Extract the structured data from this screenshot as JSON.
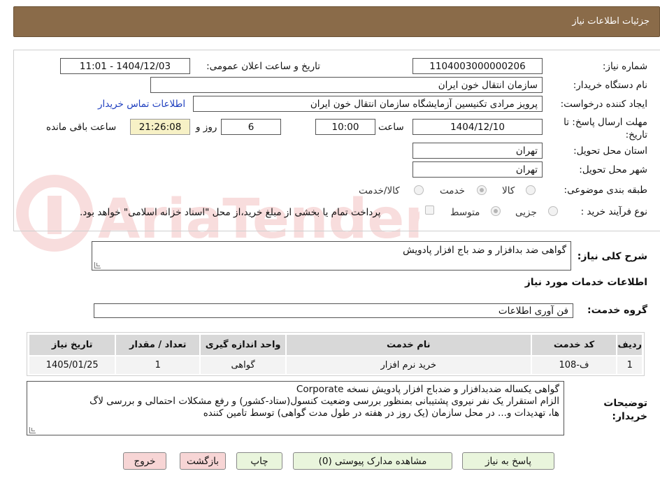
{
  "header": {
    "title": "جزئیات اطلاعات نیاز"
  },
  "form": {
    "need_number_label": "شماره نیاز:",
    "need_number": "1104003000000206",
    "announce_label": "تاریخ و ساعت اعلان عمومی:",
    "announce_value": "1404/12/03 - 11:01",
    "buyer_org_label": "نام دستگاه خریدار:",
    "buyer_org": "سازمان انتقال خون ایران",
    "requester_label": "ایجاد کننده درخواست:",
    "requester": "پرویز مرادی تکنیسین آزمایشگاه سازمان انتقال خون ایران",
    "contact_link": "اطلاعات تماس خریدار",
    "deadline_label": "مهلت ارسال پاسخ: تا تاریخ:",
    "deadline_date": "1404/12/10",
    "time_label": "ساعت",
    "deadline_time": "10:00",
    "days_value": "6",
    "days_label": "روز و",
    "remaining_time": "21:26:08",
    "remaining_label": "ساعت باقی مانده",
    "province_label": "استان محل تحویل:",
    "province": "تهران",
    "city_label": "شهر محل تحویل:",
    "city": "تهران",
    "category_label": "طبقه بندی موضوعی:",
    "category_options": [
      "کالا",
      "خدمت",
      "کالا/خدمت"
    ],
    "purchase_type_label": "نوع فرآیند خرید :",
    "purchase_options": [
      "جزیی",
      "متوسط"
    ],
    "payment_note": "پرداخت تمام یا بخشی از مبلغ خرید،از محل \"اسناد خزانه اسلامی\" خواهد بود."
  },
  "description": {
    "label": "شرح کلی نیاز:",
    "value": "گواهی ضد بدافزار و ضد باج افزار پادویش"
  },
  "services": {
    "title": "اطلاعات خدمات مورد نیاز",
    "group_label": "گروه خدمت:",
    "group_value": "فن آوری اطلاعات",
    "columns": [
      "ردیف",
      "کد خدمت",
      "نام خدمت",
      "واحد اندازه گیری",
      "تعداد / مقدار",
      "تاریخ نیاز"
    ],
    "rows": [
      [
        "1",
        "ف-108",
        "خرید نرم افزار",
        "گواهی",
        "1",
        "1405/01/25"
      ]
    ]
  },
  "buyer_notes": {
    "label": "توضیحات خریدار:",
    "lines": [
      "گواهی یکساله ضدبدافزار و ضدباج افزار پادویش نسخه Corporate",
      "الزام استقرار یک نفر نیروی پشتیبانی بمنظور بررسی وضعیت کنسول(ستاد-کشور) و رفع مشکلات احتمالی و بررسی لاگ",
      "ها، تهدیدات و... در محل سازمان  (یک روز در هفته در طول مدت گواهی) توسط تامین کننده"
    ]
  },
  "buttons": {
    "respond": "پاسخ به نیاز",
    "attachments": "مشاهده مدارک پیوستی (0)",
    "print": "چاپ",
    "back": "بازگشت",
    "exit": "خروج"
  },
  "watermark": {
    "text": "AriaTender.neT"
  },
  "colors": {
    "header_bg": "#8a6b49",
    "timer_bg": "#f7f1c6",
    "btn_green": "#e9f5dc",
    "btn_red": "#f7d5d5",
    "link": "#1f3fbf"
  }
}
